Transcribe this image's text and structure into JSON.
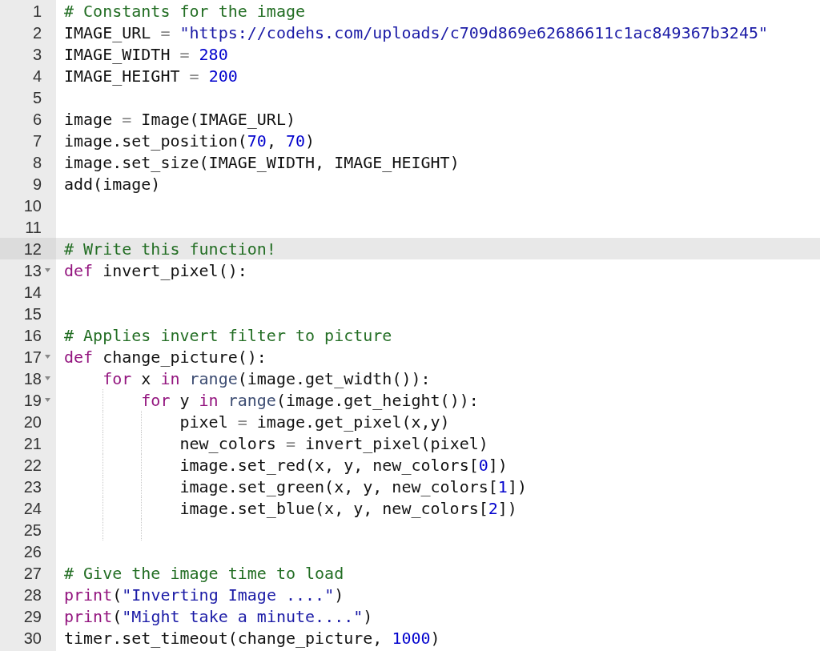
{
  "editor": {
    "lines": [
      {
        "number": "1",
        "fold": false,
        "highlighted": false,
        "tokens": [
          {
            "kind": "comment",
            "text": "# Constants for the image"
          }
        ]
      },
      {
        "number": "2",
        "fold": false,
        "highlighted": false,
        "tokens": [
          {
            "kind": "plain",
            "text": "IMAGE_URL"
          },
          {
            "kind": "operator",
            "text": " = "
          },
          {
            "kind": "string",
            "text": "\"https://codehs.com/uploads/c709d869e62686611c1ac849367b3245\""
          }
        ]
      },
      {
        "number": "3",
        "fold": false,
        "highlighted": false,
        "tokens": [
          {
            "kind": "plain",
            "text": "IMAGE_WIDTH"
          },
          {
            "kind": "operator",
            "text": " = "
          },
          {
            "kind": "number",
            "text": "280"
          }
        ]
      },
      {
        "number": "4",
        "fold": false,
        "highlighted": false,
        "tokens": [
          {
            "kind": "plain",
            "text": "IMAGE_HEIGHT"
          },
          {
            "kind": "operator",
            "text": " = "
          },
          {
            "kind": "number",
            "text": "200"
          }
        ]
      },
      {
        "number": "5",
        "fold": false,
        "highlighted": false
      },
      {
        "number": "6",
        "fold": false,
        "highlighted": false,
        "tokens": [
          {
            "kind": "plain",
            "text": "image "
          },
          {
            "kind": "operator",
            "text": "="
          },
          {
            "kind": "plain",
            "text": " Image(IMAGE_URL)"
          }
        ]
      },
      {
        "number": "7",
        "fold": false,
        "highlighted": false,
        "tokens": [
          {
            "kind": "plain",
            "text": "image.set_position("
          },
          {
            "kind": "number",
            "text": "70"
          },
          {
            "kind": "plain",
            "text": ", "
          },
          {
            "kind": "number",
            "text": "70"
          },
          {
            "kind": "plain",
            "text": ")"
          }
        ]
      },
      {
        "number": "8",
        "fold": false,
        "highlighted": false,
        "tokens": [
          {
            "kind": "plain",
            "text": "image.set_size(IMAGE_WIDTH, IMAGE_HEIGHT)"
          }
        ]
      },
      {
        "number": "9",
        "fold": false,
        "highlighted": false,
        "tokens": [
          {
            "kind": "plain",
            "text": "add(image)"
          }
        ]
      },
      {
        "number": "10",
        "fold": false,
        "highlighted": false
      },
      {
        "number": "11",
        "fold": false,
        "highlighted": false
      },
      {
        "number": "12",
        "fold": false,
        "highlighted": true,
        "tokens": [
          {
            "kind": "comment",
            "text": "# Write this function!"
          }
        ]
      },
      {
        "number": "13",
        "fold": true,
        "highlighted": false,
        "tokens": [
          {
            "kind": "keyword",
            "text": "def"
          },
          {
            "kind": "plain",
            "text": " invert_pixel():"
          }
        ]
      },
      {
        "number": "14",
        "fold": false,
        "highlighted": false
      },
      {
        "number": "15",
        "fold": false,
        "highlighted": false
      },
      {
        "number": "16",
        "fold": false,
        "highlighted": false,
        "tokens": [
          {
            "kind": "comment",
            "text": "# Applies invert filter to picture"
          }
        ]
      },
      {
        "number": "17",
        "fold": true,
        "highlighted": false,
        "tokens": [
          {
            "kind": "keyword",
            "text": "def"
          },
          {
            "kind": "plain",
            "text": " change_picture():"
          }
        ],
        "children": [
          {
            "number": "18",
            "fold": true,
            "highlighted": false,
            "tokens": [
              {
                "kind": "keyword",
                "text": "for"
              },
              {
                "kind": "plain",
                "text": " x "
              },
              {
                "kind": "keyword",
                "text": "in"
              },
              {
                "kind": "builtin",
                "text": " range"
              },
              {
                "kind": "plain",
                "text": "(image.get_width()):"
              }
            ],
            "children": [
              {
                "number": "19",
                "fold": true,
                "highlighted": false,
                "tokens": [
                  {
                    "kind": "keyword",
                    "text": "for"
                  },
                  {
                    "kind": "plain",
                    "text": " y "
                  },
                  {
                    "kind": "keyword",
                    "text": "in"
                  },
                  {
                    "kind": "builtin",
                    "text": " range"
                  },
                  {
                    "kind": "plain",
                    "text": "(image.get_height()):"
                  }
                ],
                "children": [
                  {
                    "number": "20",
                    "fold": false,
                    "highlighted": false,
                    "tokens": [
                      {
                        "kind": "plain",
                        "text": "pixel "
                      },
                      {
                        "kind": "operator",
                        "text": "="
                      },
                      {
                        "kind": "plain",
                        "text": " image.get_pixel(x,y)"
                      }
                    ]
                  },
                  {
                    "number": "21",
                    "fold": false,
                    "highlighted": false,
                    "tokens": [
                      {
                        "kind": "plain",
                        "text": "new_colors "
                      },
                      {
                        "kind": "operator",
                        "text": "="
                      },
                      {
                        "kind": "plain",
                        "text": " invert_pixel(pixel)"
                      }
                    ]
                  },
                  {
                    "number": "22",
                    "fold": false,
                    "highlighted": false,
                    "tokens": [
                      {
                        "kind": "plain",
                        "text": "image.set_red(x, y, new_colors["
                      },
                      {
                        "kind": "number",
                        "text": "0"
                      },
                      {
                        "kind": "plain",
                        "text": "])"
                      }
                    ]
                  },
                  {
                    "number": "23",
                    "fold": false,
                    "highlighted": false,
                    "tokens": [
                      {
                        "kind": "plain",
                        "text": "image.set_green(x, y, new_colors["
                      },
                      {
                        "kind": "number",
                        "text": "1"
                      },
                      {
                        "kind": "plain",
                        "text": "])"
                      }
                    ]
                  },
                  {
                    "number": "24",
                    "fold": false,
                    "highlighted": false,
                    "tokens": [
                      {
                        "kind": "plain",
                        "text": "image.set_blue(x, y, new_colors["
                      },
                      {
                        "kind": "number",
                        "text": "2"
                      },
                      {
                        "kind": "plain",
                        "text": "])"
                      }
                    ]
                  },
                  {
                    "number": "25",
                    "fold": false,
                    "highlighted": false
                  }
                ]
              }
            ]
          }
        ]
      },
      {
        "number": "26",
        "fold": false,
        "highlighted": false
      },
      {
        "number": "27",
        "fold": false,
        "highlighted": false,
        "tokens": [
          {
            "kind": "comment",
            "text": "# Give the image time to load"
          }
        ]
      },
      {
        "number": "28",
        "fold": false,
        "highlighted": false,
        "tokens": [
          {
            "kind": "keyword",
            "text": "print"
          },
          {
            "kind": "plain",
            "text": "("
          },
          {
            "kind": "string",
            "text": "\"Inverting Image ....\""
          },
          {
            "kind": "plain",
            "text": ")"
          }
        ]
      },
      {
        "number": "29",
        "fold": false,
        "highlighted": false,
        "tokens": [
          {
            "kind": "keyword",
            "text": "print"
          },
          {
            "kind": "plain",
            "text": "("
          },
          {
            "kind": "string",
            "text": "\"Might take a minute....\""
          },
          {
            "kind": "plain",
            "text": ")"
          }
        ]
      },
      {
        "number": "30",
        "fold": false,
        "highlighted": false,
        "tokens": [
          {
            "kind": "plain",
            "text": "timer.set_timeout(change_picture, "
          },
          {
            "kind": "number",
            "text": "1000"
          },
          {
            "kind": "plain",
            "text": ")"
          }
        ]
      }
    ]
  }
}
